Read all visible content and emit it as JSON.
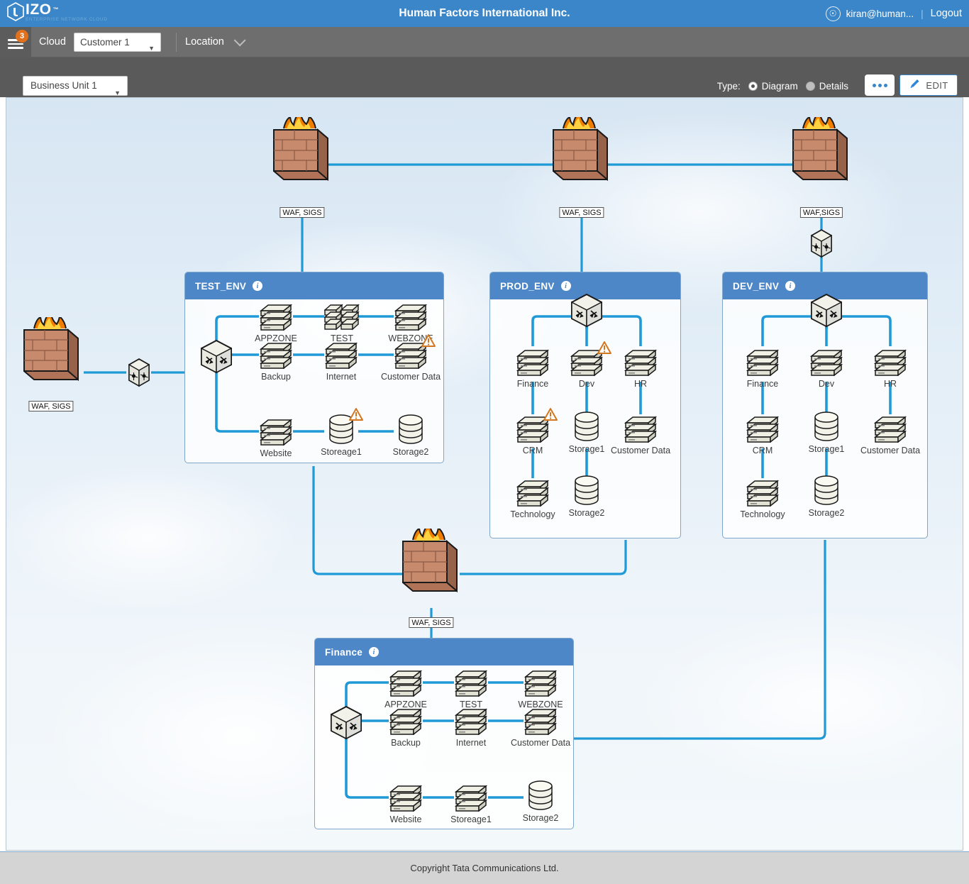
{
  "header": {
    "logo_text": "IZO",
    "logo_tm": "™",
    "logo_tagline": "ENTERPRISE NETWORK CLOUD",
    "title": "Human Factors International Inc.",
    "user_email": "kiran@human...",
    "logout_label": "Logout",
    "separator": "|"
  },
  "navbar": {
    "menu_badge": "3",
    "cloud_label": "Cloud",
    "customer_value": "Customer 1",
    "location_label": "Location",
    "caret": "▼"
  },
  "toolbar": {
    "business_unit_value": "Business Unit 1",
    "type_label": "Type:",
    "diagram_label": "Diagram",
    "details_label": "Details",
    "diagram_selected": true,
    "more_label": "•••",
    "edit_label": "EDIT"
  },
  "footer": {
    "copyright": "Copyright Tata Communications Ltd."
  },
  "colors": {
    "brand_blue": "#3b86c8",
    "panel_header": "#4d87c7",
    "link_blue": "#1f9ad6",
    "warning_orange": "#d4761f",
    "badge_orange": "#e2711d",
    "navbar_grey": "#6e6e6e",
    "toolbar_grey": "#5a5a5a",
    "footer_grey": "#d4d4d4"
  },
  "firewalls": [
    {
      "id": "fw-left",
      "label": "WAF, SIGS"
    },
    {
      "id": "fw-test-top",
      "label": "WAF, SIGS"
    },
    {
      "id": "fw-prod-top",
      "label": "WAF, SIGS"
    },
    {
      "id": "fw-dev-top",
      "label": "WAF,SIGS"
    },
    {
      "id": "fw-finance",
      "label": "WAF, SIGS"
    }
  ],
  "routers": [
    {
      "id": "router-left",
      "icon": "router-icon"
    },
    {
      "id": "router-dev",
      "icon": "router-icon"
    }
  ],
  "panels": [
    {
      "id": "test-env",
      "title": "TEST_ENV",
      "switch": {
        "icon": "switch-icon"
      },
      "nodes": [
        {
          "label": "APPZONE",
          "type": "server-stack",
          "warning": false
        },
        {
          "label": "TEST",
          "type": "server-double",
          "warning": false
        },
        {
          "label": "WEBZONE",
          "type": "server-stack",
          "warning": false
        },
        {
          "label": "Backup",
          "type": "server-stack",
          "warning": false
        },
        {
          "label": "Internet",
          "type": "server-stack",
          "warning": false
        },
        {
          "label": "Customer Data",
          "type": "server-stack",
          "warning": true
        },
        {
          "label": "Website",
          "type": "server-stack",
          "warning": false
        },
        {
          "label": "Storeage1",
          "type": "database",
          "warning": true
        },
        {
          "label": "Storage2",
          "type": "database",
          "warning": false
        }
      ]
    },
    {
      "id": "prod-env",
      "title": "PROD_ENV",
      "switch": {
        "icon": "switch-icon"
      },
      "nodes": [
        {
          "label": "Finance",
          "type": "server-stack",
          "warning": false
        },
        {
          "label": "Dev",
          "type": "server-stack",
          "warning": true
        },
        {
          "label": "HR",
          "type": "server-stack",
          "warning": false
        },
        {
          "label": "CRM",
          "type": "server-stack",
          "warning": true
        },
        {
          "label": "Storage1",
          "type": "database",
          "warning": false
        },
        {
          "label": "Customer Data",
          "type": "server-stack",
          "warning": false
        },
        {
          "label": "Technology",
          "type": "server-stack",
          "warning": false
        },
        {
          "label": "Storage2",
          "type": "database",
          "warning": false
        }
      ]
    },
    {
      "id": "dev-env",
      "title": "DEV_ENV",
      "switch": {
        "icon": "switch-icon"
      },
      "nodes": [
        {
          "label": "Finance",
          "type": "server-stack",
          "warning": false
        },
        {
          "label": "Dev",
          "type": "server-stack",
          "warning": false
        },
        {
          "label": "HR",
          "type": "server-stack",
          "warning": false
        },
        {
          "label": "CRM",
          "type": "server-stack",
          "warning": false
        },
        {
          "label": "Storage1",
          "type": "database",
          "warning": false
        },
        {
          "label": "Customer Data",
          "type": "server-stack",
          "warning": false
        },
        {
          "label": "Technology",
          "type": "server-stack",
          "warning": false
        },
        {
          "label": "Storage2",
          "type": "database",
          "warning": false
        }
      ]
    },
    {
      "id": "finance",
      "title": "Finance",
      "switch": {
        "icon": "switch-icon"
      },
      "nodes": [
        {
          "label": "APPZONE",
          "type": "server-stack",
          "warning": false
        },
        {
          "label": "TEST",
          "type": "server-stack",
          "warning": false
        },
        {
          "label": "WEBZONE",
          "type": "server-stack",
          "warning": false
        },
        {
          "label": "Backup",
          "type": "server-stack",
          "warning": false
        },
        {
          "label": "Internet",
          "type": "server-stack",
          "warning": false
        },
        {
          "label": "Customer Data",
          "type": "server-stack",
          "warning": false
        },
        {
          "label": "Website",
          "type": "server-stack",
          "warning": false
        },
        {
          "label": "Storeage1",
          "type": "server-stack",
          "warning": false
        },
        {
          "label": "Storage2",
          "type": "database",
          "warning": false
        }
      ]
    }
  ]
}
